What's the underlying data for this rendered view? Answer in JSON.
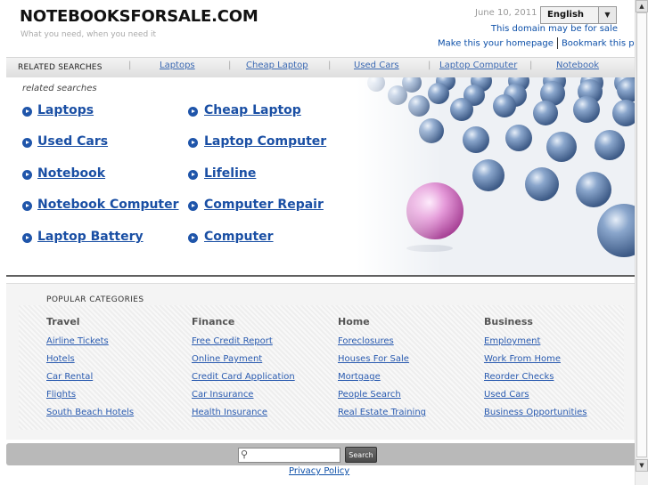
{
  "header": {
    "brand": "NOTEBOOKSFORSALE.COM",
    "tagline": "What you need, when you need it",
    "date": "June 10, 2011 |",
    "language": "English",
    "for_sale": "This domain may be for sale",
    "make_homepage": "Make this your homepage",
    "bookmark": "Bookmark this page"
  },
  "topbar": {
    "label": "RELATED SEARCHES",
    "links": [
      "Laptops",
      "Cheap Laptop",
      "Used Cars",
      "Laptop Computer",
      "Notebook"
    ]
  },
  "related": {
    "subhead": "related searches",
    "left": [
      "Laptops",
      "Used Cars",
      "Notebook",
      "Notebook Computer",
      "Laptop Battery"
    ],
    "right": [
      "Cheap Laptop",
      "Laptop Computer",
      "Lifeline",
      "Computer Repair",
      "Computer"
    ]
  },
  "categories": {
    "heading": "POPULAR CATEGORIES",
    "columns": [
      {
        "title": "Travel",
        "links": [
          "Airline Tickets",
          "Hotels",
          "Car Rental",
          "Flights",
          "South Beach Hotels"
        ]
      },
      {
        "title": "Finance",
        "links": [
          "Free Credit Report",
          "Online Payment",
          "Credit Card Application",
          "Car Insurance",
          "Health Insurance"
        ]
      },
      {
        "title": "Home",
        "links": [
          "Foreclosures",
          "Houses For Sale",
          "Mortgage",
          "People Search",
          "Real Estate Training"
        ]
      },
      {
        "title": "Business",
        "links": [
          "Employment",
          "Work From Home",
          "Reorder Checks",
          "Used Cars",
          "Business Opportunities"
        ]
      }
    ]
  },
  "footer": {
    "search_button": "Search",
    "search_value": "",
    "privacy": "Privacy Policy"
  },
  "icons": {
    "search": "search-icon",
    "bullet": "arrow-bullet-icon",
    "dropdown": "chevron-down-icon"
  },
  "colors": {
    "link": "#1a4fa4",
    "bullet": "#1f55aa",
    "sphere_blue": "#6d8db8",
    "sphere_pink": "#d070c8"
  }
}
